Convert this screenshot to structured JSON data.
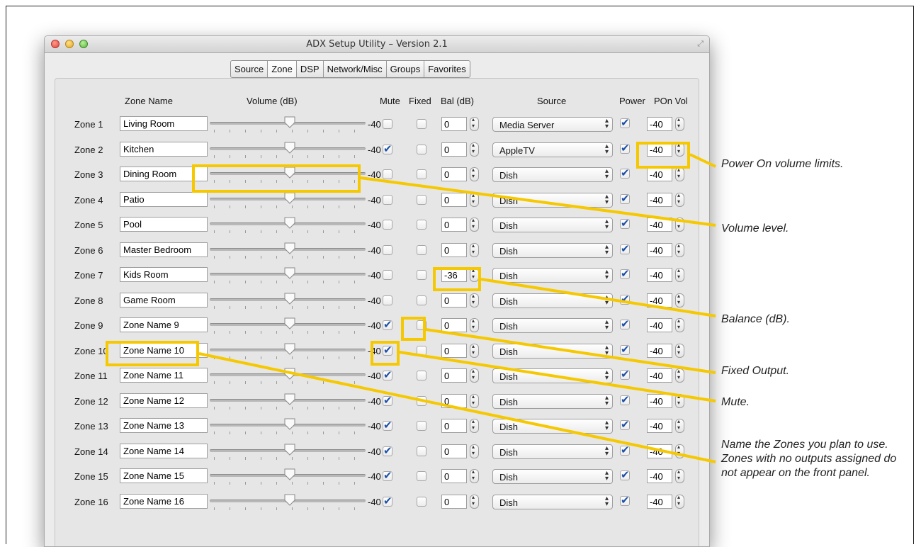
{
  "window": {
    "title": "ADX Setup Utility – Version 2.1"
  },
  "tabs": [
    {
      "label": "Source",
      "selected": false
    },
    {
      "label": "Zone",
      "selected": true
    },
    {
      "label": "DSP",
      "selected": false
    },
    {
      "label": "Network/Misc",
      "selected": false
    },
    {
      "label": "Groups",
      "selected": false
    },
    {
      "label": "Favorites",
      "selected": false
    }
  ],
  "columns": {
    "zone_name": "Zone Name",
    "volume": "Volume (dB)",
    "mute": "Mute",
    "fixed": "Fixed",
    "balance": "Bal (dB)",
    "source": "Source",
    "power": "Power",
    "pon_vol": "POn Vol"
  },
  "zones": [
    {
      "label": "Zone 1",
      "name": "Living Room",
      "volume": "-40",
      "mute": false,
      "fixed": false,
      "balance": "0",
      "source": "Media Server",
      "power": true,
      "pon_vol": "-40"
    },
    {
      "label": "Zone 2",
      "name": "Kitchen",
      "volume": "-40",
      "mute": true,
      "fixed": false,
      "balance": "0",
      "source": "AppleTV",
      "power": true,
      "pon_vol": "-40"
    },
    {
      "label": "Zone 3",
      "name": "Dining Room",
      "volume": "-40",
      "mute": false,
      "fixed": false,
      "balance": "0",
      "source": "Dish",
      "power": true,
      "pon_vol": "-40"
    },
    {
      "label": "Zone 4",
      "name": "Patio",
      "volume": "-40",
      "mute": false,
      "fixed": false,
      "balance": "0",
      "source": "Dish",
      "power": true,
      "pon_vol": "-40"
    },
    {
      "label": "Zone 5",
      "name": "Pool",
      "volume": "-40",
      "mute": false,
      "fixed": false,
      "balance": "0",
      "source": "Dish",
      "power": true,
      "pon_vol": "-40"
    },
    {
      "label": "Zone 6",
      "name": "Master Bedroom",
      "volume": "-40",
      "mute": false,
      "fixed": false,
      "balance": "0",
      "source": "Dish",
      "power": true,
      "pon_vol": "-40"
    },
    {
      "label": "Zone 7",
      "name": "Kids Room",
      "volume": "-40",
      "mute": false,
      "fixed": false,
      "balance": "-36",
      "source": "Dish",
      "power": true,
      "pon_vol": "-40"
    },
    {
      "label": "Zone 8",
      "name": "Game Room",
      "volume": "-40",
      "mute": false,
      "fixed": false,
      "balance": "0",
      "source": "Dish",
      "power": true,
      "pon_vol": "-40"
    },
    {
      "label": "Zone 9",
      "name": "Zone Name 9",
      "volume": "-40",
      "mute": true,
      "fixed": false,
      "balance": "0",
      "source": "Dish",
      "power": true,
      "pon_vol": "-40"
    },
    {
      "label": "Zone 10",
      "name": "Zone Name 10",
      "volume": "-40",
      "mute": true,
      "fixed": false,
      "balance": "0",
      "source": "Dish",
      "power": true,
      "pon_vol": "-40"
    },
    {
      "label": "Zone 11",
      "name": "Zone Name 11",
      "volume": "-40",
      "mute": true,
      "fixed": false,
      "balance": "0",
      "source": "Dish",
      "power": true,
      "pon_vol": "-40"
    },
    {
      "label": "Zone 12",
      "name": "Zone Name 12",
      "volume": "-40",
      "mute": true,
      "fixed": false,
      "balance": "0",
      "source": "Dish",
      "power": true,
      "pon_vol": "-40"
    },
    {
      "label": "Zone 13",
      "name": "Zone Name 13",
      "volume": "-40",
      "mute": true,
      "fixed": false,
      "balance": "0",
      "source": "Dish",
      "power": true,
      "pon_vol": "-40"
    },
    {
      "label": "Zone 14",
      "name": "Zone Name 14",
      "volume": "-40",
      "mute": true,
      "fixed": false,
      "balance": "0",
      "source": "Dish",
      "power": true,
      "pon_vol": "-40"
    },
    {
      "label": "Zone 15",
      "name": "Zone Name 15",
      "volume": "-40",
      "mute": true,
      "fixed": false,
      "balance": "0",
      "source": "Dish",
      "power": true,
      "pon_vol": "-40"
    },
    {
      "label": "Zone 16",
      "name": "Zone Name 16",
      "volume": "-40",
      "mute": true,
      "fixed": false,
      "balance": "0",
      "source": "Dish",
      "power": true,
      "pon_vol": "-40"
    }
  ],
  "annotations": {
    "pon_vol": "Power On volume limits.",
    "volume": "Volume level.",
    "balance": "Balance (dB).",
    "fixed": "Fixed Output.",
    "mute": "Mute.",
    "zone_name": "Name the Zones you plan to use. Zones with no outputs assigned do not appear on the front panel."
  },
  "colors": {
    "callout": "#f5c800",
    "checkmark": "#1d4fa8"
  }
}
